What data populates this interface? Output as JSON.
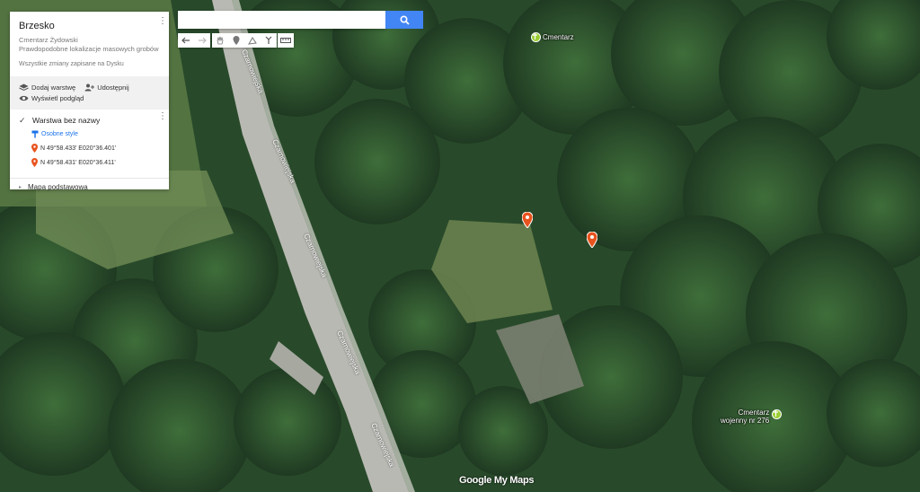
{
  "panel": {
    "map_title": "Brzesko",
    "map_desc_line1": "Cmentarz Żydowski",
    "map_desc_line2": "Prawdopodobne lokalizacje masowych grobów",
    "saved_status": "Wszystkie zmiany zapisane na Dysku",
    "add_layer": "Dodaj warstwę",
    "share": "Udostępnij",
    "preview": "Wyświetl podgląd",
    "layer_name": "Warstwa bez nazwy",
    "layer_style": "Osobne style",
    "places": [
      "N 49°58.433' E020°36.401'",
      "N 49°58.431' E020°36.411'"
    ],
    "base_map": "Mapa podstawowa"
  },
  "search": {
    "value": "",
    "placeholder": ""
  },
  "map_labels": {
    "cemetery_top": "Cmentarz",
    "war_cemetery_line1": "Cmentarz",
    "war_cemetery_line2": "wojenny nr 276",
    "street": "Czarnowiejska"
  },
  "brand": "Google My Maps",
  "colors": {
    "accent": "#4285f4",
    "marker": "#e8531e",
    "poi": "#9acd32"
  },
  "icons": {
    "search": "magnifier-icon",
    "undo": "undo-icon",
    "redo": "redo-icon",
    "hand": "hand-icon",
    "marker": "marker-icon",
    "line": "draw-line-icon",
    "directions": "directions-icon",
    "ruler": "ruler-icon"
  }
}
